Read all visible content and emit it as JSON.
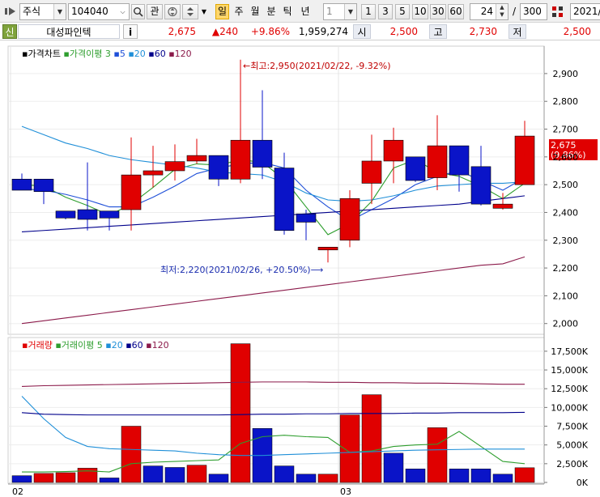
{
  "toolbar": {
    "market_select": "주식",
    "code_input": "104040",
    "btn_gwan": "관",
    "btn_il": "일",
    "btn_ju": "주",
    "btn_wol": "월",
    "btn_bun": "분",
    "btn_tik": "틱",
    "btn_nyeon": "년",
    "interval_select": "1",
    "periods": [
      "1",
      "3",
      "5",
      "10",
      "30",
      "60"
    ],
    "count_value": "24",
    "total_separator": "/",
    "total_value": "300",
    "date_field": "2021/"
  },
  "quote": {
    "tag": "신",
    "name": "대성파인텍",
    "info": "i",
    "price": "2,675",
    "change": "▲240",
    "change_pct": "+9.86%",
    "volume": "1,959,274",
    "open_label": "시",
    "open": "2,500",
    "high_label": "고",
    "high": "2,730",
    "low_label": "저",
    "low": "2,500"
  },
  "price_panel": {
    "legend": [
      {
        "label": "가격차트",
        "color": "#000000"
      },
      {
        "label": "가격이평 3",
        "color": "#2e9e2e"
      },
      {
        "label": "5",
        "color": "#1e4fd8"
      },
      {
        "label": "20",
        "color": "#1f8fd8"
      },
      {
        "label": "60",
        "color": "#00008b"
      },
      {
        "label": "120",
        "color": "#8b1a4a"
      }
    ],
    "high_annotation": "←최고:2,950(2021/02/22, -9.32%)",
    "low_annotation": "최저:2,220(2021/02/26, +20.50%)⟶",
    "price_tag": "2,675",
    "price_tag_pct": "(9.86%)",
    "y_ticks": [
      2000,
      2100,
      2200,
      2300,
      2400,
      2500,
      2600,
      2700,
      2800,
      2900
    ],
    "y_tick_labels": [
      "2,000",
      "2,100",
      "2,200",
      "2,300",
      "2,400",
      "2,500",
      "2,600",
      "2,700",
      "2,800",
      "2,900"
    ],
    "ylim": [
      1970,
      2990
    ]
  },
  "volume_panel": {
    "legend": [
      {
        "label": "거래량",
        "color": "#e00000"
      },
      {
        "label": "거래이평 5",
        "color": "#2e9e2e"
      },
      {
        "label": "20",
        "color": "#1f8fd8"
      },
      {
        "label": "60",
        "color": "#00008b"
      },
      {
        "label": "120",
        "color": "#8b1a4a"
      }
    ],
    "y_ticks": [
      0,
      2500,
      5000,
      7500,
      10000,
      12500,
      15000,
      17500
    ],
    "y_tick_labels": [
      "0K",
      "2,500K",
      "5,000K",
      "7,500K",
      "10,000K",
      "12,500K",
      "15,000K",
      "17,500K"
    ],
    "ylim": [
      0,
      19000
    ]
  },
  "x_axis_labels": [
    {
      "label": "02",
      "index": 0
    },
    {
      "label": "03",
      "index": 15
    }
  ],
  "chart_data": {
    "type": "candlestick",
    "candles": [
      {
        "open": 2520,
        "high": 2540,
        "low": 2490,
        "close": 2480
      },
      {
        "open": 2520,
        "high": 2520,
        "low": 2430,
        "close": 2475
      },
      {
        "open": 2405,
        "high": 2405,
        "low": 2375,
        "close": 2380
      },
      {
        "open": 2375,
        "high": 2580,
        "low": 2335,
        "close": 2410
      },
      {
        "open": 2405,
        "high": 2405,
        "low": 2335,
        "close": 2380
      },
      {
        "open": 2410,
        "high": 2670,
        "low": 2335,
        "close": 2535
      },
      {
        "open": 2535,
        "high": 2640,
        "low": 2490,
        "close": 2550
      },
      {
        "open": 2550,
        "high": 2645,
        "low": 2515,
        "close": 2583
      },
      {
        "open": 2585,
        "high": 2665,
        "low": 2575,
        "close": 2605
      },
      {
        "open": 2605,
        "high": 2600,
        "low": 2495,
        "close": 2520
      },
      {
        "open": 2520,
        "high": 2950,
        "low": 2505,
        "close": 2660
      },
      {
        "open": 2660,
        "high": 2840,
        "low": 2520,
        "close": 2563
      },
      {
        "open": 2560,
        "high": 2615,
        "low": 2320,
        "close": 2335
      },
      {
        "open": 2395,
        "high": 2410,
        "low": 2300,
        "close": 2365
      },
      {
        "open": 2275,
        "high": 2275,
        "low": 2220,
        "close": 2265
      },
      {
        "open": 2300,
        "high": 2480,
        "low": 2275,
        "close": 2450
      },
      {
        "open": 2505,
        "high": 2680,
        "low": 2430,
        "close": 2585
      },
      {
        "open": 2585,
        "high": 2705,
        "low": 2505,
        "close": 2660
      },
      {
        "open": 2600,
        "high": 2600,
        "low": 2510,
        "close": 2515
      },
      {
        "open": 2525,
        "high": 2750,
        "low": 2480,
        "close": 2640
      },
      {
        "open": 2640,
        "high": 2640,
        "low": 2475,
        "close": 2535
      },
      {
        "open": 2565,
        "high": 2640,
        "low": 2425,
        "close": 2430
      },
      {
        "open": 2430,
        "high": 2470,
        "low": 2410,
        "close": 2415
      },
      {
        "open": 2500,
        "high": 2730,
        "low": 2500,
        "close": 2675
      }
    ],
    "candle_colors": [
      "blue",
      "blue",
      "blue",
      "blue",
      "blue",
      "red",
      "red",
      "red",
      "red",
      "blue",
      "red",
      "blue",
      "blue",
      "blue",
      "red",
      "red",
      "red",
      "red",
      "blue",
      "red",
      "blue",
      "blue",
      "red",
      "red"
    ],
    "price_ma": [
      {
        "name": "가격이평 3",
        "color": "#2e9e2e",
        "values": [
          2500,
          2495,
          2455,
          2425,
          2390,
          2430,
          2490,
          2555,
          2575,
          2570,
          2590,
          2580,
          2520,
          2420,
          2320,
          2360,
          2440,
          2560,
          2590,
          2545,
          2530,
          2495,
          2450,
          2505
        ]
      },
      {
        "name": "5",
        "color": "#1e4fd8",
        "values": [
          2485,
          2480,
          2465,
          2445,
          2420,
          2420,
          2455,
          2495,
          2540,
          2560,
          2575,
          2580,
          2560,
          2480,
          2420,
          2370,
          2410,
          2450,
          2500,
          2530,
          2550,
          2515,
          2480,
          2525
        ]
      },
      {
        "name": "20",
        "color": "#1f8fd8",
        "values": [
          2710,
          2680,
          2650,
          2630,
          2605,
          2590,
          2580,
          2570,
          2560,
          2545,
          2540,
          2535,
          2510,
          2470,
          2445,
          2440,
          2445,
          2460,
          2480,
          2495,
          2500,
          2505,
          2505,
          2510
        ]
      },
      {
        "name": "60",
        "color": "#00008b",
        "values": [
          2330,
          2335,
          2340,
          2345,
          2350,
          2355,
          2360,
          2365,
          2370,
          2375,
          2380,
          2385,
          2390,
          2395,
          2400,
          2405,
          2410,
          2415,
          2420,
          2425,
          2430,
          2440,
          2450,
          2460
        ]
      },
      {
        "name": "120",
        "color": "#8b1a4a",
        "values": [
          2000,
          2010,
          2020,
          2030,
          2040,
          2050,
          2060,
          2070,
          2080,
          2090,
          2100,
          2110,
          2120,
          2130,
          2140,
          2150,
          2160,
          2170,
          2180,
          2190,
          2200,
          2210,
          2215,
          2240
        ]
      }
    ],
    "volume": [
      900,
      1200,
      1300,
      1900,
      600,
      7500,
      2200,
      2000,
      2300,
      1100,
      18500,
      7200,
      2200,
      1100,
      1100,
      9000,
      11700,
      3900,
      1800,
      7300,
      1800,
      1800,
      1100,
      1960
    ],
    "volume_colors": [
      "blue",
      "red",
      "red",
      "red",
      "blue",
      "red",
      "blue",
      "blue",
      "red",
      "blue",
      "red",
      "blue",
      "blue",
      "blue",
      "red",
      "red",
      "red",
      "blue",
      "blue",
      "red",
      "blue",
      "blue",
      "blue",
      "red"
    ],
    "volume_ma": [
      {
        "name": "거래이평 5",
        "color": "#2e9e2e",
        "values": [
          1400,
          1400,
          1450,
          1550,
          1400,
          2500,
          2700,
          2800,
          2900,
          3000,
          5200,
          6100,
          6300,
          6100,
          6000,
          4000,
          4200,
          4800,
          5000,
          5100,
          6800,
          4800,
          2800,
          2500
        ]
      },
      {
        "name": "20",
        "color": "#1f8fd8",
        "values": [
          11500,
          8500,
          6000,
          4800,
          4500,
          4400,
          4300,
          4200,
          3900,
          3700,
          3600,
          3600,
          3700,
          3800,
          3900,
          4000,
          4100,
          4200,
          4300,
          4350,
          4400,
          4450,
          4450,
          4450
        ]
      },
      {
        "name": "60",
        "color": "#00008b",
        "values": [
          9300,
          9100,
          9050,
          9000,
          9000,
          9000,
          9000,
          9000,
          9000,
          9000,
          9050,
          9100,
          9100,
          9150,
          9150,
          9200,
          9200,
          9200,
          9250,
          9250,
          9300,
          9300,
          9300,
          9350
        ]
      },
      {
        "name": "120",
        "color": "#8b1a4a",
        "values": [
          12800,
          12900,
          12950,
          13000,
          13050,
          13100,
          13150,
          13200,
          13250,
          13300,
          13350,
          13400,
          13400,
          13400,
          13350,
          13350,
          13300,
          13300,
          13250,
          13250,
          13200,
          13150,
          13100,
          13100
        ]
      }
    ]
  }
}
